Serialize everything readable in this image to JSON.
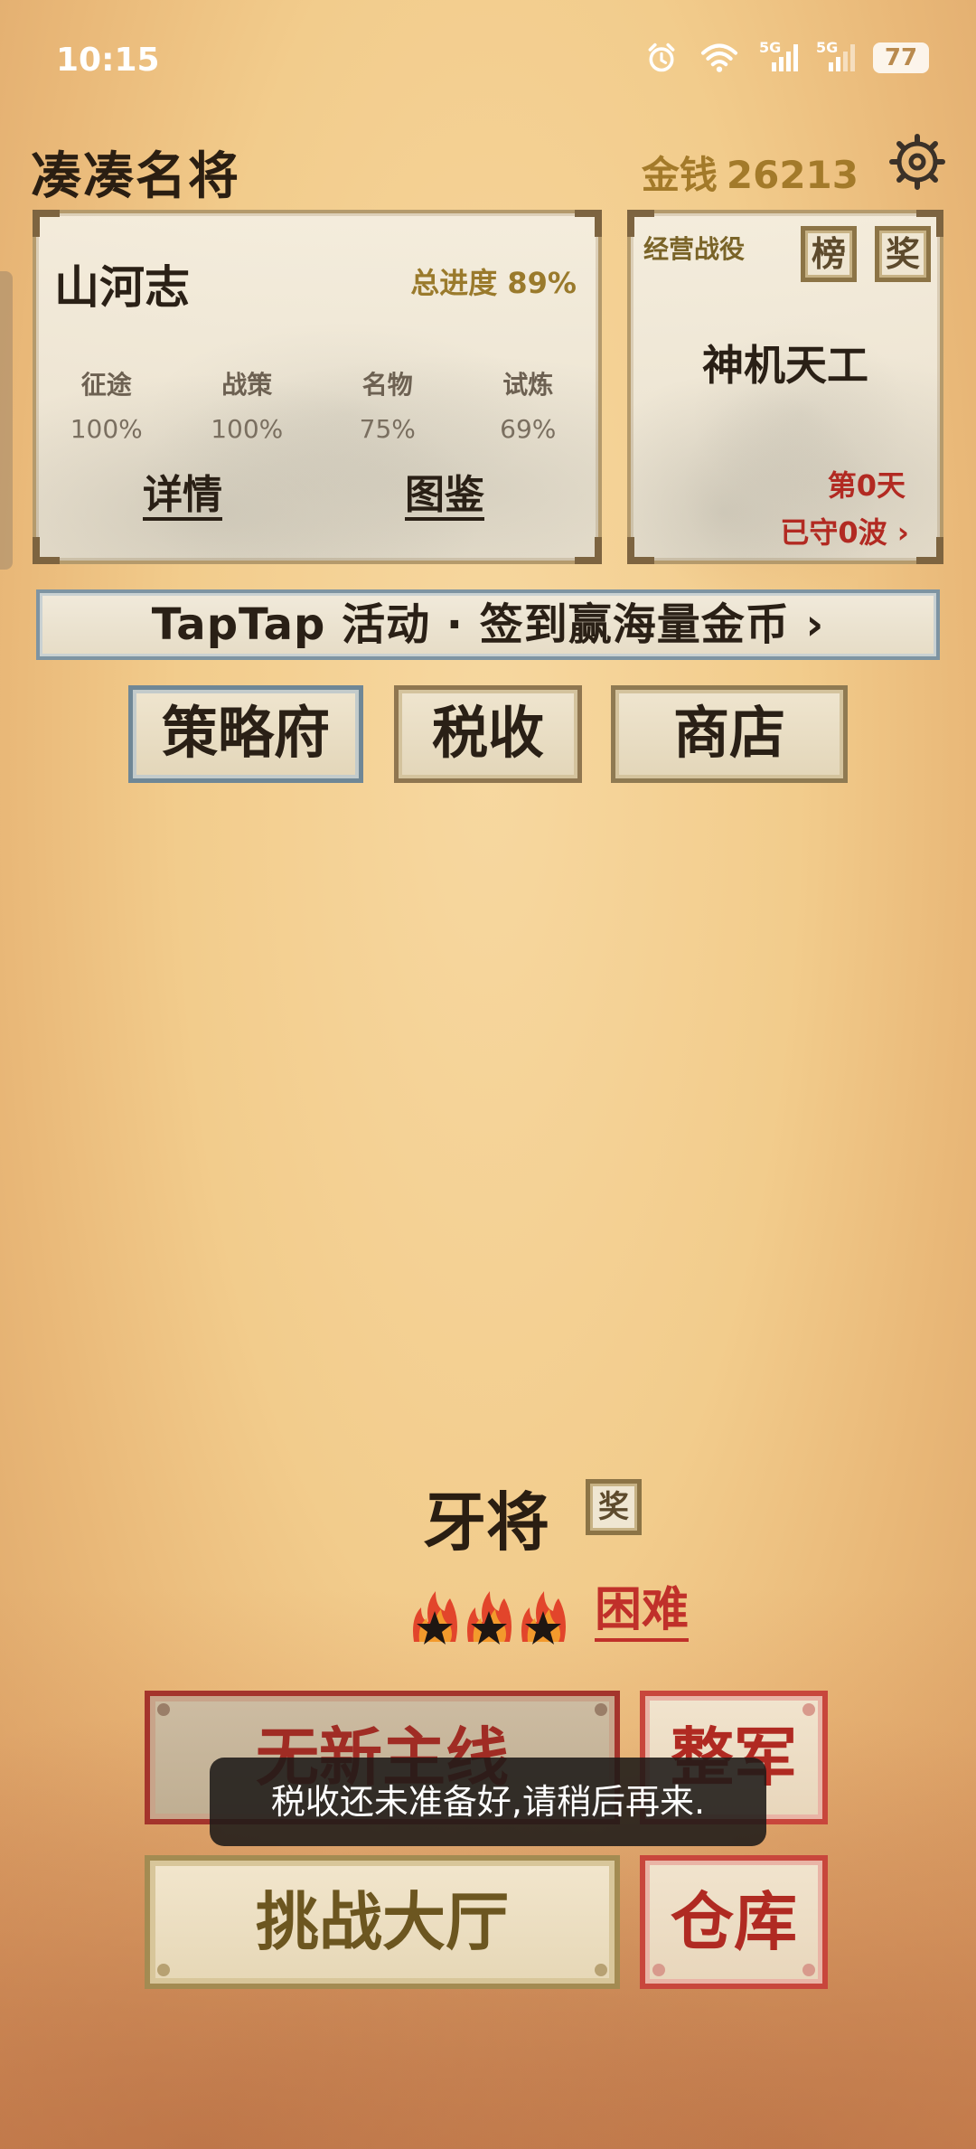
{
  "status_bar": {
    "time": "10:15",
    "battery": "77",
    "network_1": "5G",
    "network_2": "5G"
  },
  "header": {
    "title": "凑凑名将",
    "money_label": "金钱",
    "money_value": "26213"
  },
  "main_card": {
    "title": "山河志",
    "progress": "总进度 89%",
    "stats": [
      {
        "name": "征途",
        "value": "100%"
      },
      {
        "name": "战策",
        "value": "100%"
      },
      {
        "name": "名物",
        "value": "75%"
      },
      {
        "name": "试炼",
        "value": "69%"
      }
    ],
    "detail_link": "详情",
    "album_link": "图鉴"
  },
  "side_card": {
    "label": "经营战役",
    "rank_button": "榜",
    "prize_button": "奖",
    "name": "神机天工",
    "day": "第0天",
    "wave": "已守0波 ›"
  },
  "banner": {
    "text": "TapTap 活动 · 签到赢海量金币 ›"
  },
  "mid_buttons": {
    "strategy": "策略府",
    "tax": "税收",
    "shop": "商店"
  },
  "rank": {
    "name": "牙将",
    "prize_button": "奖",
    "stars": 3,
    "difficulty": "困难"
  },
  "bottom_buttons": {
    "mainline": "无新主线",
    "army": "整军",
    "hall": "挑战大厅",
    "warehouse": "仓库"
  },
  "toast": {
    "message": "税收还未准备好,请稍后再来."
  },
  "colors": {
    "accent_red": "#c0302a",
    "gold_text": "#a37a2a",
    "banner_border": "#7e94a2"
  },
  "icons": [
    "alarm-icon",
    "wifi-icon",
    "signal-icon",
    "battery-icon",
    "gear-icon",
    "flame-star-icon"
  ]
}
